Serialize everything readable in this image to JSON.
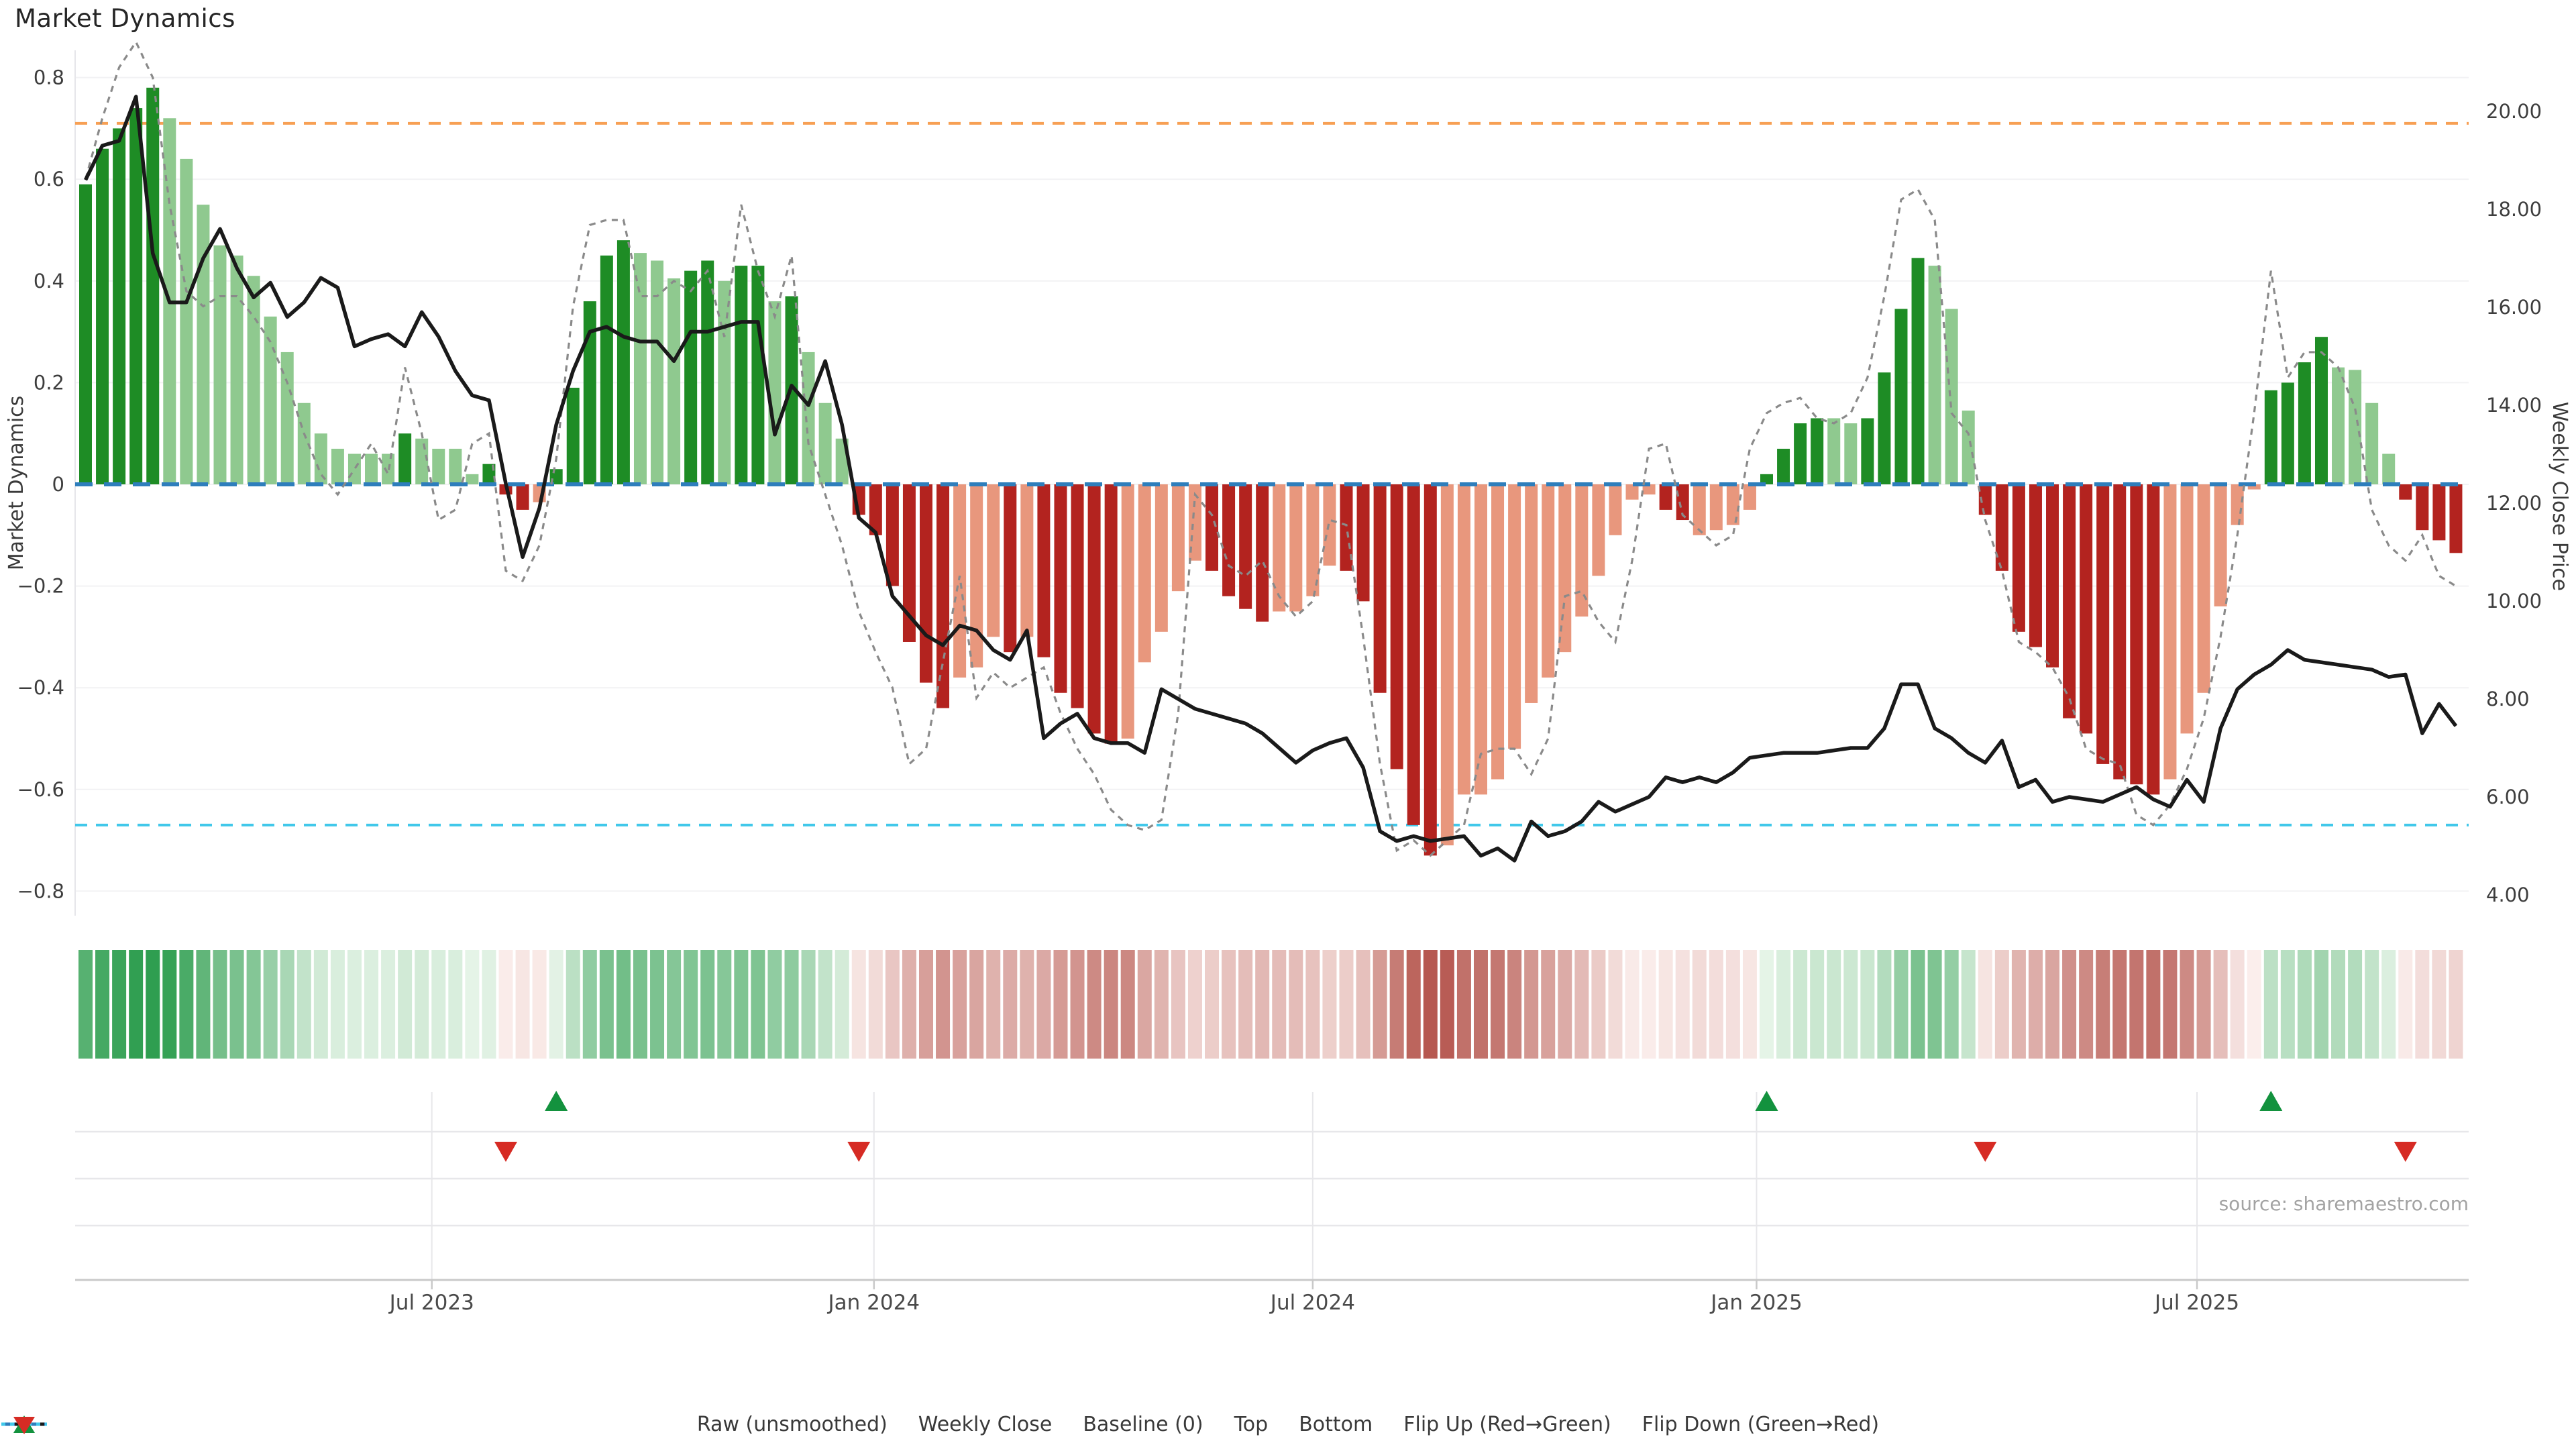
{
  "page": {
    "title": "Market Dynamics",
    "source": "source: sharemaestro.com"
  },
  "axes": {
    "left": {
      "title": "Market Dynamics",
      "ticks": [
        "0.8",
        "0.6",
        "0.4",
        "0.2",
        "0",
        "−0.2",
        "−0.4",
        "−0.6",
        "−0.8"
      ],
      "tick_values": [
        0.8,
        0.6,
        0.4,
        0.2,
        0,
        -0.2,
        -0.4,
        -0.6,
        -0.8
      ]
    },
    "right": {
      "title": "Weekly Close Price",
      "ticks": [
        "20.00",
        "18.00",
        "16.00",
        "14.00",
        "12.00",
        "10.00",
        "8.00",
        "6.00",
        "4.00"
      ],
      "tick_values": [
        20,
        18,
        16,
        14,
        12,
        10,
        8,
        6,
        4
      ]
    },
    "x": {
      "ticks": [
        "Jul 2023",
        "Jan 2024",
        "Jul 2024",
        "Jan 2025",
        "Jul 2025"
      ],
      "tick_weeks": [
        20.6,
        46.9,
        73.0,
        99.4,
        125.6
      ]
    }
  },
  "legend": {
    "items": [
      {
        "label": "Raw (unsmoothed)",
        "type": "line-dashed",
        "color": "#8a8a8a"
      },
      {
        "label": "Weekly Close",
        "type": "line-solid",
        "color": "#1a1a1a"
      },
      {
        "label": "Baseline (0)",
        "type": "line-longdash",
        "color": "#2e7ebc"
      },
      {
        "label": "Top",
        "type": "line-dotted",
        "color": "#f7a054"
      },
      {
        "label": "Bottom",
        "type": "line-dotted",
        "color": "#41c8ea"
      },
      {
        "label": "Flip Up (Red→Green)",
        "type": "triangle-up",
        "color": "#13923e"
      },
      {
        "label": "Flip Down (Green→Red)",
        "type": "triangle-down",
        "color": "#d62b24"
      }
    ]
  },
  "colors": {
    "bar_pos_dark": "#1e8c25",
    "bar_pos_light": "#8fc98f",
    "bar_neg_dark": "#b3231f",
    "bar_neg_light": "#e8977d",
    "baseline": "#2e7ebc",
    "top_line": "#f7a054",
    "bottom_line": "#41c8ea",
    "raw_line": "#8a8a8a",
    "price_line": "#1a1a1a",
    "grid_main": "#f2f2f4",
    "grid_panel": "#e7e7ea",
    "axis_line": "#c9c9c9",
    "tick_text": "#3d3d3d",
    "flip_up": "#13923e",
    "flip_down": "#d62b24",
    "heat_pos_max": "#2f9e50",
    "heat_neg_max": "#b4544c"
  },
  "chart_data": {
    "type": "bar+line combo with heatmap strip and flip markers",
    "x_unit": "weekly, Feb 2023 – Oct 2025",
    "ylabel_left": "Market Dynamics",
    "ylabel_right": "Weekly Close Price",
    "ylim_left": [
      -0.8,
      0.8
    ],
    "ylim_right": [
      4,
      20
    ],
    "baseline_value": 0,
    "top_value": 0.71,
    "bottom_value": -0.67,
    "dynamics": [
      0.59,
      0.66,
      0.7,
      0.74,
      0.78,
      0.72,
      0.64,
      0.55,
      0.47,
      0.45,
      0.41,
      0.33,
      0.26,
      0.16,
      0.1,
      0.07,
      0.06,
      0.06,
      0.06,
      0.1,
      0.09,
      0.07,
      0.07,
      0.02,
      0.04,
      -0.02,
      -0.05,
      -0.035,
      0.03,
      0.19,
      0.36,
      0.45,
      0.48,
      0.455,
      0.44,
      0.405,
      0.42,
      0.44,
      0.4,
      0.43,
      0.43,
      0.36,
      0.37,
      0.26,
      0.16,
      0.09,
      -0.06,
      -0.1,
      -0.2,
      -0.31,
      -0.39,
      -0.44,
      -0.38,
      -0.36,
      -0.3,
      -0.33,
      -0.3,
      -0.34,
      -0.41,
      -0.44,
      -0.49,
      -0.51,
      -0.5,
      -0.35,
      -0.29,
      -0.21,
      -0.15,
      -0.17,
      -0.22,
      -0.245,
      -0.27,
      -0.25,
      -0.25,
      -0.22,
      -0.16,
      -0.17,
      -0.23,
      -0.41,
      -0.56,
      -0.67,
      -0.73,
      -0.71,
      -0.61,
      -0.61,
      -0.58,
      -0.52,
      -0.43,
      -0.38,
      -0.33,
      -0.26,
      -0.18,
      -0.1,
      -0.03,
      -0.02,
      -0.05,
      -0.07,
      -0.1,
      -0.09,
      -0.08,
      -0.05,
      0.02,
      0.07,
      0.12,
      0.13,
      0.13,
      0.12,
      0.13,
      0.22,
      0.345,
      0.445,
      0.43,
      0.345,
      0.145,
      -0.06,
      -0.17,
      -0.29,
      -0.32,
      -0.36,
      -0.46,
      -0.49,
      -0.55,
      -0.58,
      -0.59,
      -0.61,
      -0.58,
      -0.49,
      -0.41,
      -0.24,
      -0.08,
      -0.01,
      0.185,
      0.2,
      0.24,
      0.29,
      0.23,
      0.225,
      0.16,
      0.06,
      -0.03,
      -0.09,
      -0.11,
      -0.135
    ],
    "shade": "dddddlllllllllllllldlllldddlddddd llldd l dd l d lll dd ddddllldldddddlllllddddl lllddddddllllllllllllldd llllddddllddddlllddddddd ddddllllllddddlllldddd",
    "raw": [
      0.6,
      0.72,
      0.82,
      0.87,
      0.8,
      0.55,
      0.38,
      0.35,
      0.37,
      0.37,
      0.33,
      0.28,
      0.2,
      0.1,
      0.02,
      -0.02,
      0.03,
      0.08,
      0.02,
      0.23,
      0.1,
      -0.07,
      -0.05,
      0.08,
      0.1,
      -0.17,
      -0.19,
      -0.12,
      0.05,
      0.35,
      0.51,
      0.52,
      0.52,
      0.37,
      0.37,
      0.4,
      0.38,
      0.42,
      0.29,
      0.55,
      0.42,
      0.33,
      0.45,
      0.08,
      -0.02,
      -0.12,
      -0.25,
      -0.33,
      -0.4,
      -0.55,
      -0.52,
      -0.35,
      -0.18,
      -0.42,
      -0.37,
      -0.4,
      -0.38,
      -0.36,
      -0.45,
      -0.52,
      -0.57,
      -0.64,
      -0.67,
      -0.68,
      -0.66,
      -0.45,
      -0.02,
      -0.06,
      -0.16,
      -0.18,
      -0.15,
      -0.22,
      -0.26,
      -0.23,
      -0.07,
      -0.08,
      -0.3,
      -0.55,
      -0.72,
      -0.7,
      -0.73,
      -0.7,
      -0.67,
      -0.53,
      -0.52,
      -0.52,
      -0.57,
      -0.5,
      -0.22,
      -0.21,
      -0.27,
      -0.31,
      -0.15,
      0.07,
      0.08,
      -0.06,
      -0.09,
      -0.12,
      -0.1,
      0.07,
      0.14,
      0.16,
      0.17,
      0.13,
      0.12,
      0.14,
      0.21,
      0.37,
      0.56,
      0.58,
      0.52,
      0.14,
      0.1,
      -0.07,
      -0.17,
      -0.31,
      -0.33,
      -0.36,
      -0.42,
      -0.52,
      -0.54,
      -0.55,
      -0.65,
      -0.67,
      -0.63,
      -0.56,
      -0.46,
      -0.3,
      -0.1,
      0.14,
      0.42,
      0.21,
      0.26,
      0.26,
      0.23,
      0.15,
      -0.05,
      -0.12,
      -0.15,
      -0.1,
      -0.18,
      -0.2
    ],
    "price": [
      18.6,
      19.3,
      19.4,
      20.3,
      17.1,
      16.1,
      16.1,
      17.0,
      17.6,
      16.8,
      16.2,
      16.5,
      15.8,
      16.1,
      16.6,
      16.4,
      15.2,
      15.35,
      15.45,
      15.2,
      15.9,
      15.4,
      14.7,
      14.2,
      14.1,
      12.4,
      10.9,
      11.9,
      13.6,
      14.7,
      15.5,
      15.6,
      15.4,
      15.3,
      15.3,
      14.9,
      15.5,
      15.5,
      15.6,
      15.7,
      15.7,
      13.4,
      14.4,
      14.0,
      14.9,
      13.6,
      11.7,
      11.4,
      10.1,
      9.7,
      9.3,
      9.1,
      9.5,
      9.4,
      9.0,
      8.8,
      9.4,
      7.2,
      7.5,
      7.7,
      7.2,
      7.1,
      7.1,
      6.9,
      8.2,
      8.0,
      7.8,
      7.7,
      7.6,
      7.5,
      7.3,
      7.0,
      6.7,
      6.95,
      7.1,
      7.2,
      6.6,
      5.3,
      5.1,
      5.2,
      5.1,
      5.15,
      5.2,
      4.8,
      4.95,
      4.7,
      5.5,
      5.2,
      5.3,
      5.5,
      5.9,
      5.7,
      5.85,
      6.0,
      6.4,
      6.3,
      6.4,
      6.3,
      6.5,
      6.8,
      6.85,
      6.9,
      6.9,
      6.9,
      6.95,
      7.0,
      7.0,
      7.4,
      8.3,
      8.3,
      7.4,
      7.2,
      6.9,
      6.7,
      7.15,
      6.2,
      6.35,
      5.9,
      6.0,
      5.95,
      5.9,
      6.05,
      6.2,
      5.95,
      5.8,
      6.35,
      5.9,
      7.4,
      8.2,
      8.5,
      8.7,
      9.0,
      8.8,
      8.75,
      8.7,
      8.65,
      8.6,
      8.45,
      8.5,
      7.3,
      7.9,
      7.45
    ],
    "flip_up_weeks": [
      28,
      100,
      130
    ],
    "flip_down_weeks": [
      25,
      46,
      113,
      138
    ],
    "heatmap": "derived: cell color = sign/magnitude of dynamics value, |v| scaled to 0.75"
  }
}
